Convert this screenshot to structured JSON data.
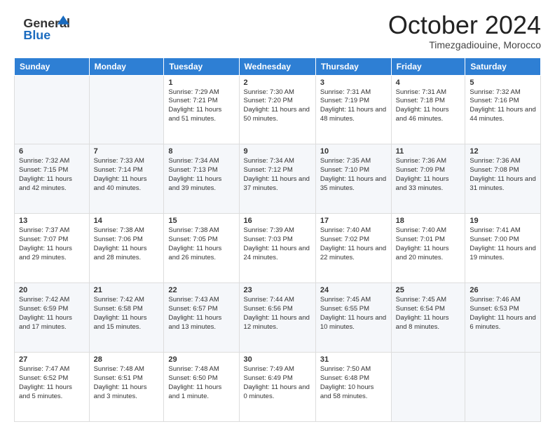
{
  "header": {
    "logo_general": "General",
    "logo_blue": "Blue",
    "month_title": "October 2024",
    "subtitle": "Timezgadiouine, Morocco"
  },
  "days_of_week": [
    "Sunday",
    "Monday",
    "Tuesday",
    "Wednesday",
    "Thursday",
    "Friday",
    "Saturday"
  ],
  "weeks": [
    [
      {
        "day": "",
        "info": ""
      },
      {
        "day": "",
        "info": ""
      },
      {
        "day": "1",
        "info": "Sunrise: 7:29 AM\nSunset: 7:21 PM\nDaylight: 11 hours and 51 minutes."
      },
      {
        "day": "2",
        "info": "Sunrise: 7:30 AM\nSunset: 7:20 PM\nDaylight: 11 hours and 50 minutes."
      },
      {
        "day": "3",
        "info": "Sunrise: 7:31 AM\nSunset: 7:19 PM\nDaylight: 11 hours and 48 minutes."
      },
      {
        "day": "4",
        "info": "Sunrise: 7:31 AM\nSunset: 7:18 PM\nDaylight: 11 hours and 46 minutes."
      },
      {
        "day": "5",
        "info": "Sunrise: 7:32 AM\nSunset: 7:16 PM\nDaylight: 11 hours and 44 minutes."
      }
    ],
    [
      {
        "day": "6",
        "info": "Sunrise: 7:32 AM\nSunset: 7:15 PM\nDaylight: 11 hours and 42 minutes."
      },
      {
        "day": "7",
        "info": "Sunrise: 7:33 AM\nSunset: 7:14 PM\nDaylight: 11 hours and 40 minutes."
      },
      {
        "day": "8",
        "info": "Sunrise: 7:34 AM\nSunset: 7:13 PM\nDaylight: 11 hours and 39 minutes."
      },
      {
        "day": "9",
        "info": "Sunrise: 7:34 AM\nSunset: 7:12 PM\nDaylight: 11 hours and 37 minutes."
      },
      {
        "day": "10",
        "info": "Sunrise: 7:35 AM\nSunset: 7:10 PM\nDaylight: 11 hours and 35 minutes."
      },
      {
        "day": "11",
        "info": "Sunrise: 7:36 AM\nSunset: 7:09 PM\nDaylight: 11 hours and 33 minutes."
      },
      {
        "day": "12",
        "info": "Sunrise: 7:36 AM\nSunset: 7:08 PM\nDaylight: 11 hours and 31 minutes."
      }
    ],
    [
      {
        "day": "13",
        "info": "Sunrise: 7:37 AM\nSunset: 7:07 PM\nDaylight: 11 hours and 29 minutes."
      },
      {
        "day": "14",
        "info": "Sunrise: 7:38 AM\nSunset: 7:06 PM\nDaylight: 11 hours and 28 minutes."
      },
      {
        "day": "15",
        "info": "Sunrise: 7:38 AM\nSunset: 7:05 PM\nDaylight: 11 hours and 26 minutes."
      },
      {
        "day": "16",
        "info": "Sunrise: 7:39 AM\nSunset: 7:03 PM\nDaylight: 11 hours and 24 minutes."
      },
      {
        "day": "17",
        "info": "Sunrise: 7:40 AM\nSunset: 7:02 PM\nDaylight: 11 hours and 22 minutes."
      },
      {
        "day": "18",
        "info": "Sunrise: 7:40 AM\nSunset: 7:01 PM\nDaylight: 11 hours and 20 minutes."
      },
      {
        "day": "19",
        "info": "Sunrise: 7:41 AM\nSunset: 7:00 PM\nDaylight: 11 hours and 19 minutes."
      }
    ],
    [
      {
        "day": "20",
        "info": "Sunrise: 7:42 AM\nSunset: 6:59 PM\nDaylight: 11 hours and 17 minutes."
      },
      {
        "day": "21",
        "info": "Sunrise: 7:42 AM\nSunset: 6:58 PM\nDaylight: 11 hours and 15 minutes."
      },
      {
        "day": "22",
        "info": "Sunrise: 7:43 AM\nSunset: 6:57 PM\nDaylight: 11 hours and 13 minutes."
      },
      {
        "day": "23",
        "info": "Sunrise: 7:44 AM\nSunset: 6:56 PM\nDaylight: 11 hours and 12 minutes."
      },
      {
        "day": "24",
        "info": "Sunrise: 7:45 AM\nSunset: 6:55 PM\nDaylight: 11 hours and 10 minutes."
      },
      {
        "day": "25",
        "info": "Sunrise: 7:45 AM\nSunset: 6:54 PM\nDaylight: 11 hours and 8 minutes."
      },
      {
        "day": "26",
        "info": "Sunrise: 7:46 AM\nSunset: 6:53 PM\nDaylight: 11 hours and 6 minutes."
      }
    ],
    [
      {
        "day": "27",
        "info": "Sunrise: 7:47 AM\nSunset: 6:52 PM\nDaylight: 11 hours and 5 minutes."
      },
      {
        "day": "28",
        "info": "Sunrise: 7:48 AM\nSunset: 6:51 PM\nDaylight: 11 hours and 3 minutes."
      },
      {
        "day": "29",
        "info": "Sunrise: 7:48 AM\nSunset: 6:50 PM\nDaylight: 11 hours and 1 minute."
      },
      {
        "day": "30",
        "info": "Sunrise: 7:49 AM\nSunset: 6:49 PM\nDaylight: 11 hours and 0 minutes."
      },
      {
        "day": "31",
        "info": "Sunrise: 7:50 AM\nSunset: 6:48 PM\nDaylight: 10 hours and 58 minutes."
      },
      {
        "day": "",
        "info": ""
      },
      {
        "day": "",
        "info": ""
      }
    ]
  ]
}
